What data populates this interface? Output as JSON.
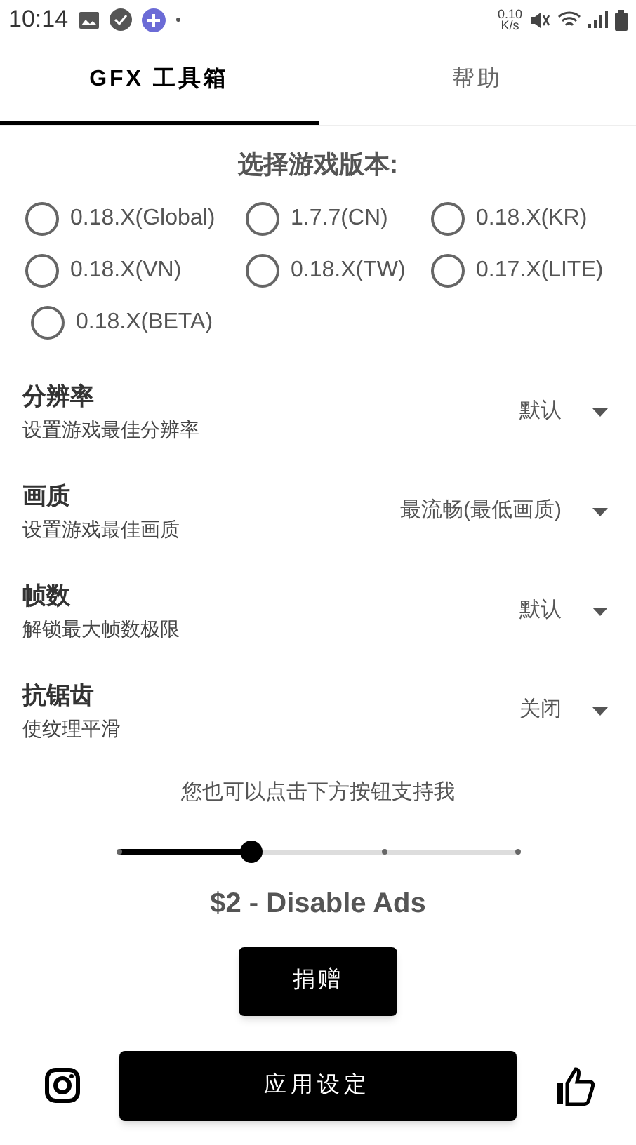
{
  "status_bar": {
    "time": "10:14",
    "speed_value": "0.10",
    "speed_unit": "K/s"
  },
  "tabs": [
    {
      "label": "GFX 工具箱",
      "selected": true
    },
    {
      "label": "帮助",
      "selected": false
    }
  ],
  "version_heading": "选择游戏版本:",
  "versions": [
    {
      "label": "0.18.X(Global)",
      "selected": false
    },
    {
      "label": "1.7.7(CN)",
      "selected": false
    },
    {
      "label": "0.18.X(KR)",
      "selected": false
    },
    {
      "label": "0.18.X(VN)",
      "selected": false
    },
    {
      "label": "0.18.X(TW)",
      "selected": false
    },
    {
      "label": "0.17.X(LITE)",
      "selected": false
    },
    {
      "label": "0.18.X(BETA)",
      "selected": false
    }
  ],
  "settings": [
    {
      "title": "分辨率",
      "subtitle": "设置游戏最佳分辨率",
      "value": "默认"
    },
    {
      "title": "画质",
      "subtitle": "设置游戏最佳画质",
      "value": "最流畅(最低画质)"
    },
    {
      "title": "帧数",
      "subtitle": "解锁最大帧数极限",
      "value": "默认"
    },
    {
      "title": "抗锯齿",
      "subtitle": "使纹理平滑",
      "value": "关闭"
    }
  ],
  "support_text": "您也可以点击下方按钮支持我",
  "donation_slider": {
    "level": 0.3333
  },
  "donation_label": "$2 - Disable Ads",
  "donate_button": "捐赠",
  "apply_button": "应用设定"
}
